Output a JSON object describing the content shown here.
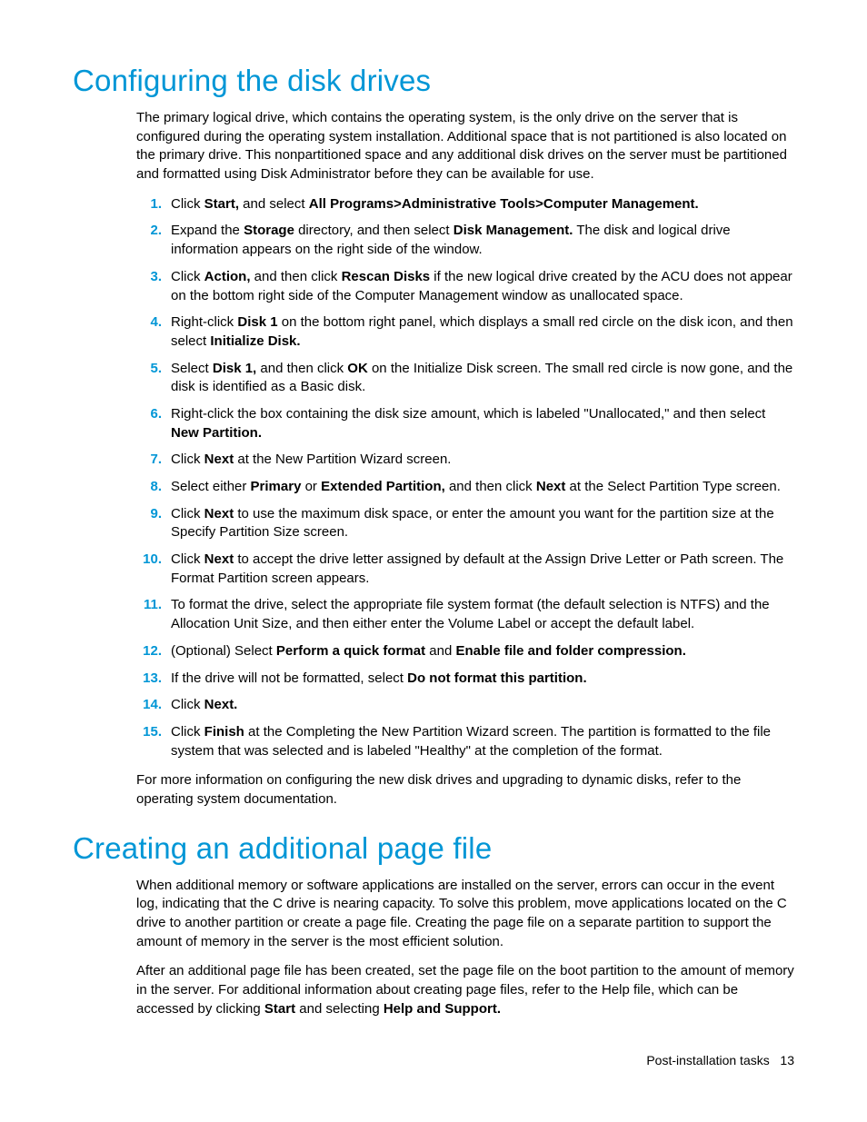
{
  "section1": {
    "heading": "Configuring the disk drives",
    "intro": "The primary logical drive, which contains the operating system, is the only drive on the server that is configured during the operating system installation. Additional space that is not partitioned is also located on the primary drive. This nonpartitioned space and any additional disk drives on the server must be partitioned and formatted using Disk Administrator before they can be available for use.",
    "steps": [
      "Click <b>Start,</b> and select <b>All Programs>Administrative Tools>Computer Management.</b>",
      "Expand the <b>Storage</b> directory, and then select <b>Disk Management.</b> The disk and logical drive information appears on the right side of the window.",
      "Click <b>Action,</b> and then click <b>Rescan Disks</b> if the new logical drive created by the ACU does not appear on the bottom right side of the Computer Management window as unallocated space.",
      "Right-click <b>Disk 1</b> on the bottom right panel, which displays a small red circle on the disk icon, and then select <b>Initialize Disk.</b>",
      "Select <b>Disk 1,</b> and then click <b>OK</b> on the Initialize Disk screen. The small red circle is now gone, and the disk is identified as a Basic disk.",
      "Right-click the box containing the disk size amount, which is labeled \"Unallocated,\" and then select <b>New Partition.</b>",
      "Click <b>Next</b> at the New Partition Wizard screen.",
      "Select either <b>Primary</b> or <b>Extended Partition,</b> and then click <b>Next</b> at the Select Partition Type screen.",
      "Click <b>Next</b> to use the maximum disk space, or enter the amount you want for the partition size at the Specify Partition Size screen.",
      "Click <b>Next</b> to accept the drive letter assigned by default at the Assign Drive Letter or Path screen. The Format Partition screen appears.",
      "To format the drive, select the appropriate file system format (the default selection is NTFS) and the Allocation Unit Size, and then either enter the Volume Label or accept the default label.",
      "(Optional) Select <b>Perform a quick format</b> and <b>Enable file and folder compression.</b>",
      "If the drive will not be formatted, select <b>Do not format this partition.</b>",
      "Click <b>Next.</b>",
      "Click <b>Finish</b> at the Completing the New Partition Wizard screen. The partition is formatted to the file system that was selected and is labeled \"Healthy\" at the completion of the format."
    ],
    "outro": "For more information on configuring the new disk drives and upgrading to dynamic disks, refer to the operating system documentation."
  },
  "section2": {
    "heading": "Creating an additional page file",
    "para1": "When additional memory or software applications are installed on the server, errors can occur in the event log, indicating that the C drive is nearing capacity. To solve this problem, move applications located on the C drive to another partition or create a page file. Creating the page file on a separate partition to support the amount of memory in the server is the most efficient solution.",
    "para2": "After an additional page file has been created, set the page file on the boot partition to the amount of memory in the server. For additional information about creating page files, refer to the Help file, which can be accessed by clicking <b>Start</b> and selecting <b>Help and Support.</b>"
  },
  "footer": {
    "label": "Post-installation tasks",
    "page": "13"
  }
}
